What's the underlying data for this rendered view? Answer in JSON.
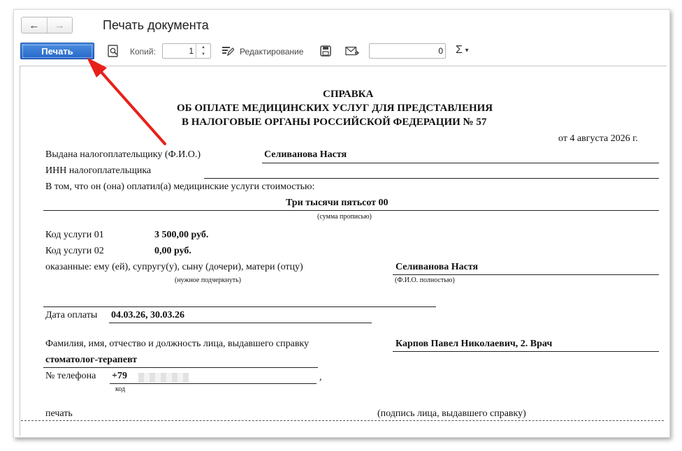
{
  "window": {
    "title": "Печать документа",
    "back_icon": "arrow-left-icon",
    "forward_icon": "arrow-right-icon"
  },
  "toolbar": {
    "print_label": "Печать",
    "copies_label": "Копий:",
    "copies_value": "1",
    "edit_label": "Редактирование",
    "sum_value": "0",
    "sigma_label": "Σ"
  },
  "document": {
    "title_lines": [
      "СПРАВКА",
      "ОБ ОПЛАТЕ МЕДИЦИНСКИХ УСЛУГ ДЛЯ ПРЕДСТАВЛЕНИЯ",
      "В НАЛОГОВЫЕ ОРГАНЫ РОССИЙСКОЙ ФЕДЕРАЦИИ № 57"
    ],
    "date": "от 4 августа 2026 г.",
    "issued_label": "Выдана налогоплательщику (Ф.И.О.)",
    "issued_value": "Селиванова Настя",
    "inn_label": "ИНН налогоплательщика",
    "paid_text": "В том, что он (она) оплатил(а) медицинские услуги стоимостью:",
    "amount_words": "Три тысячи пятьсот  00",
    "amount_words_hint": "(сумма прописью)",
    "service1_label": "Код услуги 01",
    "service1_value": "3 500,00 руб.",
    "service2_label": "Код услуги 02",
    "service2_value": "0,00 руб.",
    "rendered_label": "оказанные: ему (ей), супругу(у), сыну (дочери), матери (отцу)",
    "rendered_value": "Селиванова Настя",
    "underline_hint": "(нужное подчеркнуть)",
    "fio_hint": "(Ф.И.О. полностью)",
    "pay_date_label": "Дата оплаты",
    "pay_date_value": "04.03.26, 30.03.26",
    "issuer_label": "Фамилия, имя, отчество и должность лица, выдавшего справку",
    "issuer_value": "Карпов Павел Николаевич, 2. Врач",
    "issuer_value2": "стоматолог-терапевт",
    "phone_label": "№ телефона",
    "phone_value": "+79",
    "phone_comma": ",",
    "code_hint": "код",
    "stamp_label": "печать",
    "signature_label": "(подпись лица, выдавшего справку)"
  },
  "colors": {
    "accent": "#2667c9",
    "arrow": "#e8201a"
  }
}
